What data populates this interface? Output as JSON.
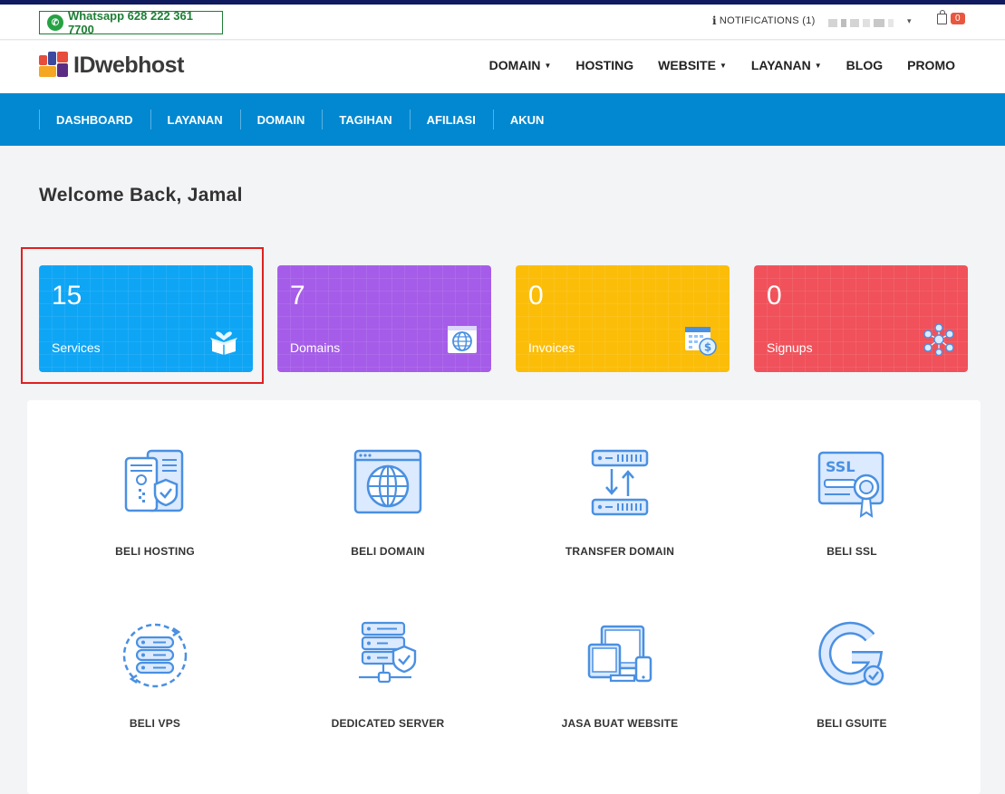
{
  "topbar": {
    "whatsapp": "Whatsapp  628 222 361 7700",
    "notifications": "NOTIFICATIONS (1)",
    "cart_count": "0"
  },
  "brand": {
    "name": "IDwebhost"
  },
  "main_nav": [
    {
      "label": "DOMAIN",
      "dropdown": true
    },
    {
      "label": "HOSTING",
      "dropdown": false
    },
    {
      "label": "WEBSITE",
      "dropdown": true
    },
    {
      "label": "LAYANAN",
      "dropdown": true
    },
    {
      "label": "BLOG",
      "dropdown": false
    },
    {
      "label": "PROMO",
      "dropdown": false
    }
  ],
  "sub_nav": [
    "DASHBOARD",
    "LAYANAN",
    "DOMAIN",
    "TAGIHAN",
    "AFILIASI",
    "AKUN"
  ],
  "welcome": "Welcome Back, Jamal",
  "stats": [
    {
      "value": "15",
      "label": "Services",
      "color": "#0ea5f5",
      "icon": "gift-box-icon",
      "highlighted": true
    },
    {
      "value": "7",
      "label": "Domains",
      "color": "#a55ce8",
      "icon": "globe-window-icon",
      "highlighted": false
    },
    {
      "value": "0",
      "label": "Invoices",
      "color": "#fbbd08",
      "icon": "calendar-dollar-icon",
      "highlighted": false
    },
    {
      "value": "0",
      "label": "Signups",
      "color": "#f0515a",
      "icon": "network-icon",
      "highlighted": false
    }
  ],
  "tiles": [
    {
      "label": "BELI HOSTING",
      "icon": "hosting-icon"
    },
    {
      "label": "BELI DOMAIN",
      "icon": "domain-globe-icon"
    },
    {
      "label": "TRANSFER DOMAIN",
      "icon": "transfer-icon"
    },
    {
      "label": "BELI SSL",
      "icon": "ssl-certificate-icon"
    },
    {
      "label": "BELI VPS",
      "icon": "vps-server-icon"
    },
    {
      "label": "DEDICATED SERVER",
      "icon": "dedicated-server-icon"
    },
    {
      "label": "JASA BUAT WEBSITE",
      "icon": "devices-icon"
    },
    {
      "label": "BELI GSUITE",
      "icon": "gsuite-icon"
    }
  ],
  "colors": {
    "accent": "#0288d1",
    "icon_blue": "#4a90e2",
    "icon_fill": "#dbeafe"
  }
}
